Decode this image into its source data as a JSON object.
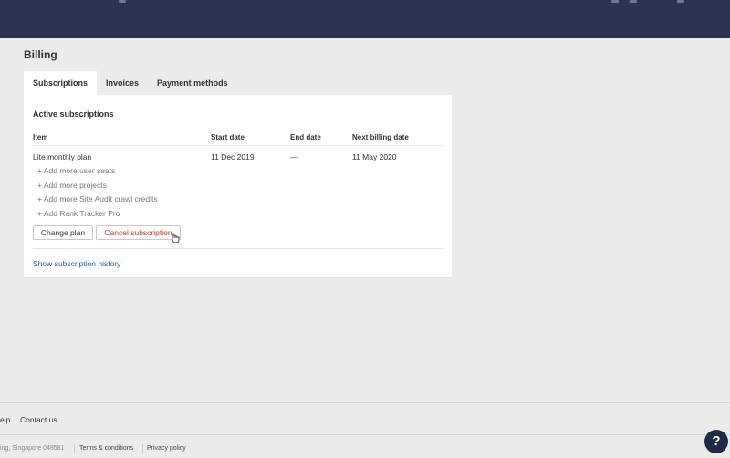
{
  "page": {
    "title": "Billing"
  },
  "tabs": [
    {
      "label": "Subscriptions",
      "active": true
    },
    {
      "label": "Invoices",
      "active": false
    },
    {
      "label": "Payment methods",
      "active": false
    }
  ],
  "subscriptions": {
    "section_title": "Active subscriptions",
    "columns": [
      "Item",
      "Start date",
      "End date",
      "Next billing date"
    ],
    "rows": [
      {
        "item": "Lite monthly plan",
        "start_date": "11 Dec 2019",
        "end_date": "—",
        "next_billing_date": "11 May 2020"
      }
    ],
    "addons": [
      "+ Add more user seats",
      "+ Add more projects",
      "+ Add more Site Audit crawl credits",
      "+ Add Rank Tracker Pro"
    ],
    "change_plan_label": "Change plan",
    "cancel_label": "Cancel subscription",
    "history_link": "Show subscription history"
  },
  "footer": {
    "help_label": "elp",
    "contact_label": "Contact us",
    "address": "ing, Singapore 048581",
    "terms_label": "Terms & conditions",
    "privacy_label": "Privacy policy",
    "help_button": "?"
  },
  "colors": {
    "header_bg": "#2a3550",
    "link": "#2d5a9c",
    "danger": "#c0392b",
    "page_bg": "#ececec"
  }
}
